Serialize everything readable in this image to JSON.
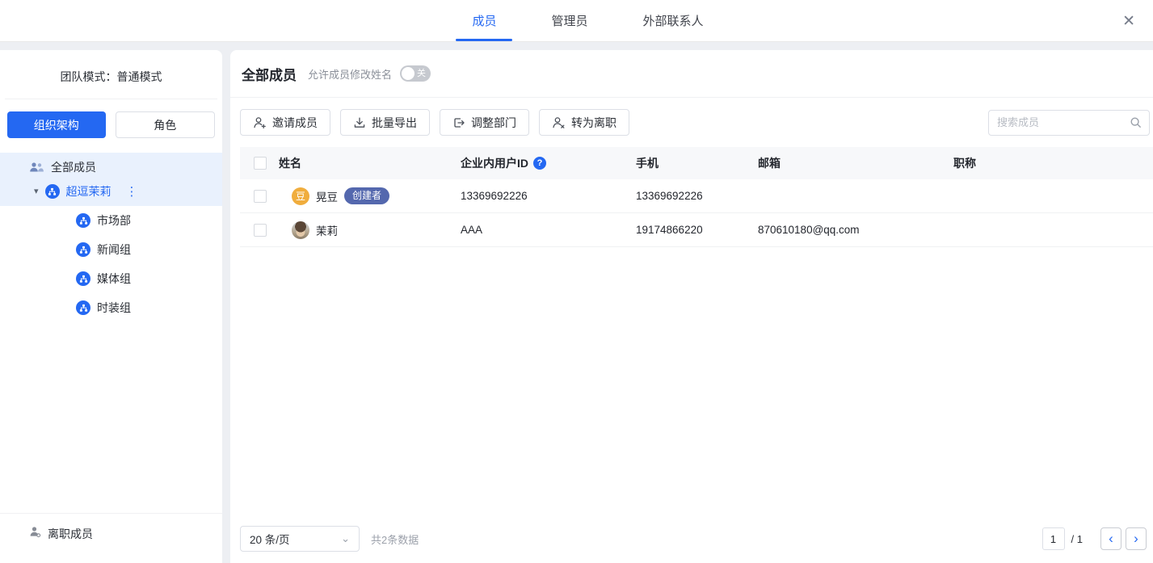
{
  "topbar": {
    "tabs": {
      "members": "成员",
      "admins": "管理员",
      "external": "外部联系人"
    }
  },
  "sidebar": {
    "team_mode": "团队模式：普通模式",
    "org_button": "组织架构",
    "role_button": "角色",
    "tree": {
      "all_members": "全部成员",
      "company": "超逗茉莉",
      "departments": [
        "市场部",
        "新闻组",
        "媒体组",
        "时装组"
      ]
    },
    "resigned": "离职成员"
  },
  "main": {
    "title": "全部成员",
    "toggle_label": "允许成员修改姓名",
    "toggle_state": "关",
    "actions": {
      "invite": "邀请成员",
      "export": "批量导出",
      "adjust": "调整部门",
      "resign": "转为离职"
    },
    "search": {
      "placeholder": "搜索成员"
    },
    "table": {
      "headers": {
        "name": "姓名",
        "user_id": "企业内用户ID",
        "phone": "手机",
        "email": "邮箱",
        "title": "职称"
      },
      "rows": [
        {
          "name": "晃豆",
          "avatar_text": "豆",
          "badge": "创建者",
          "user_id": "13369692226",
          "phone": "13369692226",
          "email": "",
          "title": ""
        },
        {
          "name": "茉莉",
          "avatar_text": "",
          "user_id": "AAA",
          "phone": "19174866220",
          "email": "870610180@qq.com",
          "title": ""
        }
      ]
    },
    "footer": {
      "page_size": "20 条/页",
      "total": "共2条数据",
      "current_page": "1",
      "page_of": "/ 1"
    }
  },
  "icons": {
    "close": "✕",
    "more": "⋮",
    "caret_down": "▾",
    "select_caret": "⌄",
    "prev": "‹",
    "next": "›",
    "help": "?"
  },
  "colors": {
    "primary": "#2468f2",
    "selected_bg": "#e9f1fd",
    "badge": "#5468ae",
    "avatar_yellow": "#f0ad3d",
    "toggle_off": "#c6c9cf"
  }
}
